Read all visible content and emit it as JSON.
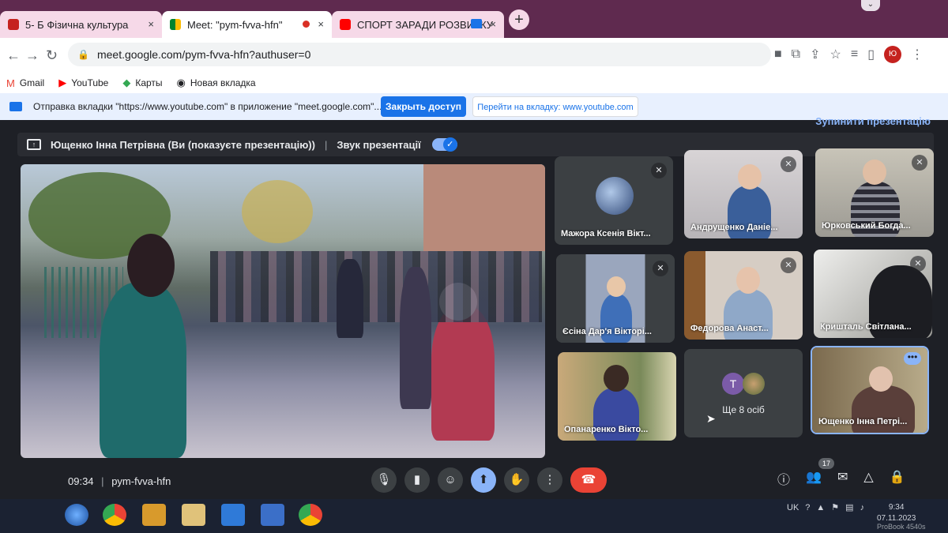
{
  "browser": {
    "tabs": [
      {
        "label": "5- Б Фізична культура",
        "close": "×"
      },
      {
        "label": "Meet: \"pym-fvva-hfn\"",
        "close": "×"
      },
      {
        "label": "СПОРТ ЗАРАДИ РОЗВИТКУ",
        "close": "×"
      }
    ],
    "new_tab": "+",
    "url": "meet.google.com/pym-fvva-hfn?authuser=0",
    "profile_initial": "Ю",
    "bookmarks": [
      {
        "label": "Gmail",
        "icon": "gmail-icon"
      },
      {
        "label": "YouTube",
        "icon": "youtube-icon"
      },
      {
        "label": "Карты",
        "icon": "maps-icon"
      },
      {
        "label": "Новая вкладка",
        "icon": "globe-icon"
      }
    ],
    "sharebar": {
      "message": "Отправка вкладки \"https://www.youtube.com\" в приложение \"meet.google.com\"...",
      "stop_button": "Закрыть доступ",
      "go_button": "Перейти на вкладку: www.youtube.com"
    }
  },
  "meet": {
    "stop_presentation": "Зупинити презентацію",
    "presenter_label": "Ющенко Інна Петрівна (Ви (показуєте презентацію))",
    "separator": "|",
    "audio_label": "Звук презентації",
    "participants": [
      {
        "name": "Мажора Ксенія Вікт..."
      },
      {
        "name": "Андрущенко Даніе..."
      },
      {
        "name": "Юрковський Богда..."
      },
      {
        "name": "Єсіна Дар'я Вікторі..."
      },
      {
        "name": "Федорова Анаст..."
      },
      {
        "name": "Кришталь Світлана..."
      },
      {
        "name": "Опанаренко Вікто..."
      },
      {
        "name": "Ющенко Інна Петрі..."
      }
    ],
    "more_tile": {
      "label": "Ще 8 осіб",
      "avatar_letter": "T"
    },
    "self_dots": "•••",
    "time": "09:34",
    "meeting_code": "pym-fvva-hfn",
    "info_separator": "|",
    "people_count": "17"
  },
  "taskbar": {
    "language": "UK",
    "time": "9:34",
    "date": "07.11.2023",
    "brand": "ProBook 4540s"
  },
  "colors": {
    "accent": "#8ab4f8",
    "end_call": "#ea4335",
    "share_blue": "#1a73e8"
  }
}
